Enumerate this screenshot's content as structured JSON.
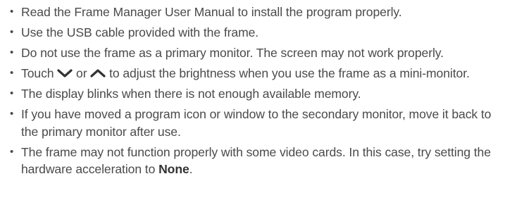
{
  "notes": [
    {
      "text": "Read the Frame Manager User Manual to install the program properly."
    },
    {
      "text": "Use the USB cable provided with the frame."
    },
    {
      "text": "Do not use the frame as a primary monitor. The screen may not work properly."
    },
    {
      "before": "Touch ",
      "icon_down": "chevron-down-icon",
      "middle": " or ",
      "icon_up": "chevron-up-icon",
      "after": " to adjust the brightness when you use the frame as a mini-monitor."
    },
    {
      "text": "The display blinks when there is not enough available memory."
    },
    {
      "text": "If you have moved a program icon or window to the secondary monitor, move it back to the primary monitor after use."
    },
    {
      "before": "The frame may not function properly with some video cards. In this case, try setting the hardware acceleration to ",
      "bold": "None",
      "after": "."
    }
  ],
  "bullet_char": "•",
  "colors": {
    "text": "#4a4a4a",
    "bold": "#333333"
  }
}
